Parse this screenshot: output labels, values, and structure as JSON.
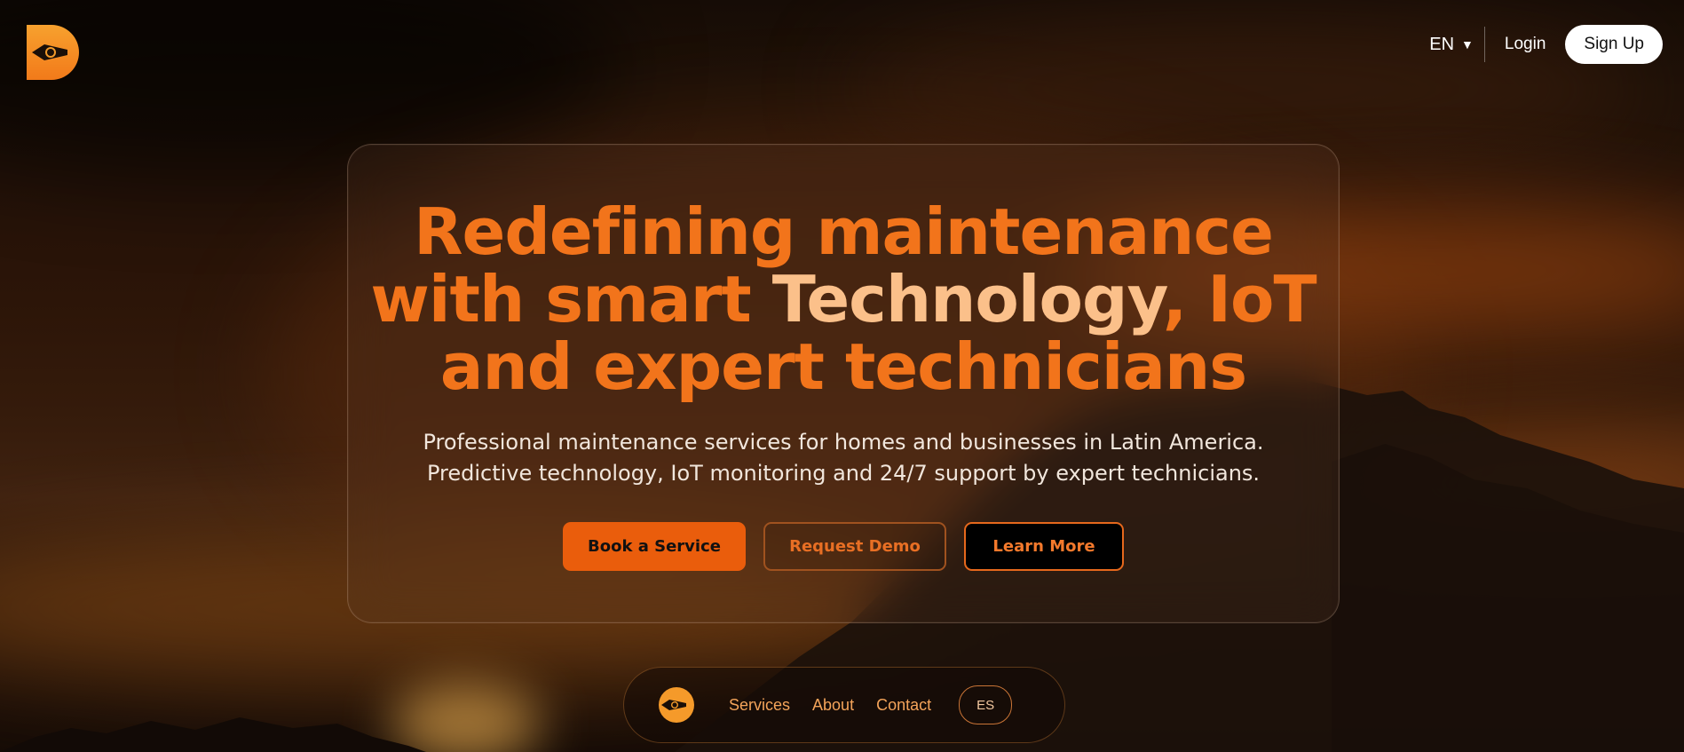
{
  "header": {
    "language": "EN",
    "login_label": "Login",
    "signup_label": "Sign Up"
  },
  "hero": {
    "headline_part1": "Redefining maintenance",
    "headline_part2": "with smart ",
    "headline_highlight": "Technology",
    "headline_part3": ", IoT",
    "headline_part4": "and expert technicians",
    "subtitle_line1": "Professional maintenance services for homes and businesses in Latin America.",
    "subtitle_line2": "Predictive technology, IoT monitoring and 24/7 support by expert technicians.",
    "buttons": {
      "book": "Book a Service",
      "demo": "Request Demo",
      "learn": "Learn More"
    }
  },
  "bottom_nav": {
    "links": [
      "Services",
      "About",
      "Contact"
    ],
    "language_toggle": "ES"
  },
  "icons": {
    "logo": "brand-logo-icon",
    "caret": "chevron-down-icon"
  },
  "colors": {
    "accent": "#f2741b",
    "highlight": "#fbc08a",
    "primary_button": "#ea5d0c",
    "link": "#f4a45a"
  }
}
